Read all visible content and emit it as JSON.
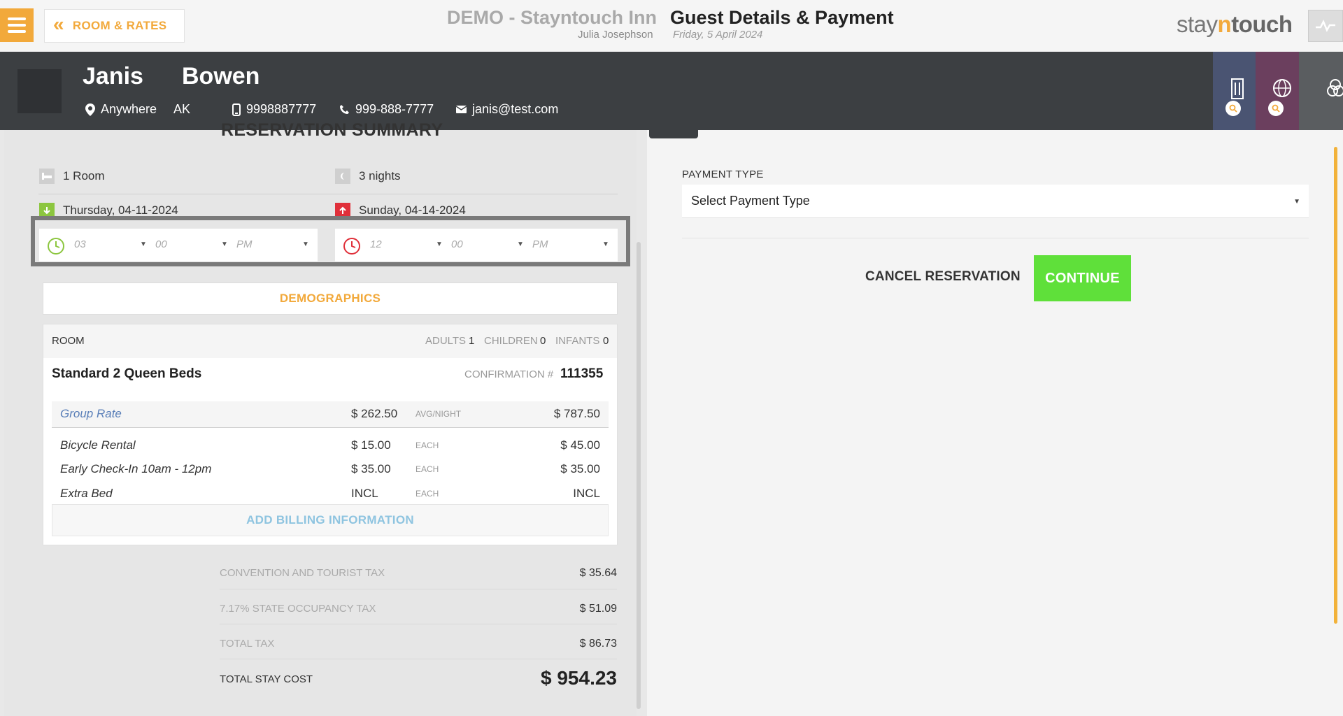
{
  "header": {
    "back_label": "ROOM & RATES",
    "hotel_name": "DEMO - Stayntouch Inn",
    "page_title": "Guest Details & Payment",
    "user_name": "Julia Josephson",
    "date": "Friday, 5 April 2024",
    "logo_stay": "stay",
    "logo_n": "n",
    "logo_touch": "touch"
  },
  "guest": {
    "first_name": "Janis",
    "last_name": "Bowen",
    "city": "Anywhere",
    "state": "AK",
    "mobile": "9998887777",
    "phone": "999-888-7777",
    "email": "janis@test.com"
  },
  "summary": {
    "title": "RESERVATION SUMMARY",
    "rooms": "1 Room",
    "nights": "3 nights",
    "arrival_date": "Thursday, 04-11-2024",
    "departure_date": "Sunday, 04-14-2024",
    "arrival_time": {
      "hour": "03",
      "minute": "00",
      "ampm": "PM"
    },
    "departure_time": {
      "hour": "12",
      "minute": "00",
      "ampm": "PM"
    },
    "demographics_label": "DEMOGRAPHICS"
  },
  "room": {
    "label": "ROOM",
    "adults_label": "ADULTS",
    "adults": "1",
    "children_label": "CHILDREN",
    "children": "0",
    "infants_label": "INFANTS",
    "infants": "0",
    "type": "Standard 2 Queen Beds",
    "confirmation_label": "CONFIRMATION #",
    "confirmation": "111355",
    "rate": {
      "name": "Group Rate",
      "price": "$ 262.50",
      "unit": "AVG/NIGHT",
      "total": "$ 787.50"
    },
    "addons": [
      {
        "name": "Bicycle Rental",
        "price": "$ 15.00",
        "unit": "EACH",
        "total": "$ 45.00"
      },
      {
        "name": "Early Check-In 10am - 12pm",
        "price": "$ 35.00",
        "unit": "EACH",
        "total": "$ 35.00"
      },
      {
        "name": "Extra Bed",
        "price": "INCL",
        "unit": "EACH",
        "total": "INCL"
      }
    ],
    "add_billing_label": "ADD BILLING INFORMATION"
  },
  "taxes": [
    {
      "label": "CONVENTION AND TOURIST TAX",
      "value": "$ 35.64"
    },
    {
      "label": "7.17% STATE OCCUPANCY TAX",
      "value": "$ 51.09"
    },
    {
      "label": "TOTAL TAX",
      "value": "$ 86.73"
    }
  ],
  "total": {
    "label": "TOTAL STAY COST",
    "value": "$ 954.23"
  },
  "payment": {
    "type_label": "PAYMENT TYPE",
    "select_value": "Select Payment Type",
    "cancel_label": "CANCEL RESERVATION",
    "continue_label": "CONTINUE"
  },
  "colors": {
    "accent": "#f2a93b",
    "guest_bar": "#3c3f42",
    "continue": "#5fe03a",
    "arrival": "#8cc63f",
    "departure": "#e0303a",
    "tab1": "#4a5472",
    "tab2": "#6b3f5e"
  }
}
